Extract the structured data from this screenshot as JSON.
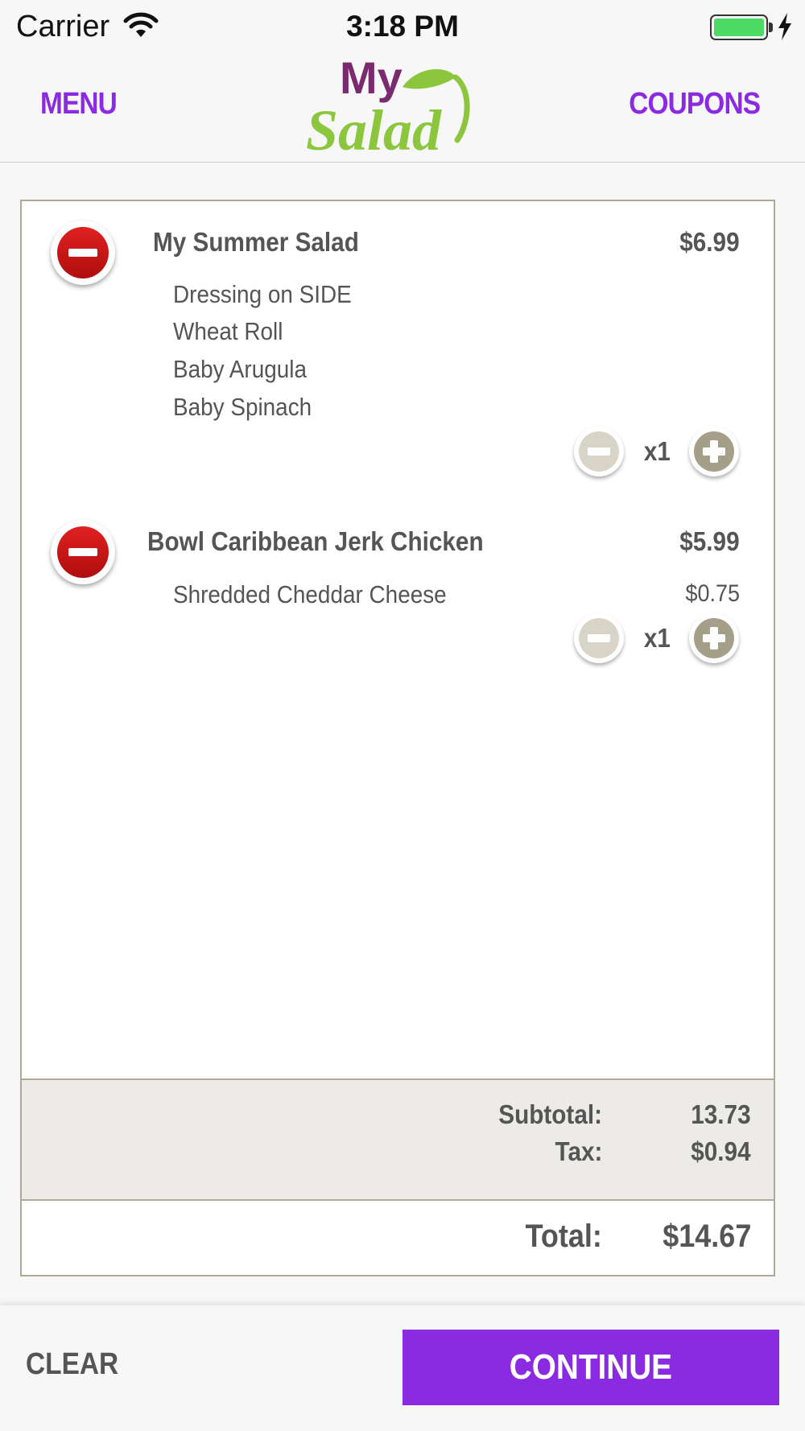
{
  "status_bar": {
    "carrier": "Carrier",
    "time": "3:18 PM",
    "battery_level": 1.0,
    "battery_color": "#4cd964"
  },
  "nav": {
    "menu_label": "MENU",
    "coupons_label": "COUPONS",
    "logo_text_top": "My",
    "logo_text_bottom": "Salad",
    "accent_color": "#8a2be2"
  },
  "order": {
    "items": [
      {
        "name": "My Summer Salad",
        "price": "$6.99",
        "modifiers": [
          {
            "name": "Dressing on SIDE",
            "price": ""
          },
          {
            "name": "Wheat Roll",
            "price": ""
          },
          {
            "name": "Baby Arugula",
            "price": ""
          },
          {
            "name": "Baby Spinach",
            "price": ""
          }
        ],
        "quantity": "x1"
      },
      {
        "name": "Bowl  Caribbean Jerk Chicken",
        "price": "$5.99",
        "modifiers": [
          {
            "name": "Shredded Cheddar Cheese",
            "price": "$0.75"
          }
        ],
        "quantity": "x1"
      }
    ],
    "subtotal_label": "Subtotal:",
    "subtotal_value": "13.73",
    "tax_label": "Tax:",
    "tax_value": "$0.94",
    "total_label": "Total:",
    "total_value": "$14.67"
  },
  "footer": {
    "clear_label": "CLEAR",
    "continue_label": "CONTINUE"
  },
  "icons": [
    "wifi-icon",
    "battery-icon",
    "charging-bolt-icon",
    "remove-item-icon",
    "minus-icon",
    "plus-icon",
    "leaf-icon"
  ]
}
